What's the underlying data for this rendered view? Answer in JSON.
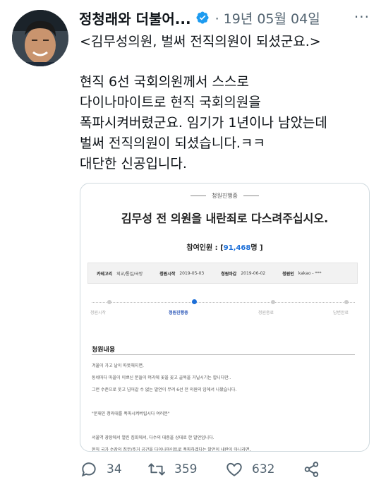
{
  "tweet": {
    "author_name": "정청래와 더불어...",
    "meta": "· 19년 05월 04일",
    "more_label": "···",
    "first_line": "<김무성의원, 벌써 전직의원이 되셨군요.>",
    "body": "현직 6선 국회의원께서 스스로\n다이나마이트로 현직 국회의원을\n폭파시켜버렸군요. 임기가 1년이나 남았는데\n벌써 전직의원이 되셨습니다.ㅋㅋ\n대단한 신공입니다."
  },
  "card": {
    "status": "청원진행중",
    "title": "김무성 전 의원을 내란죄로 다스려주십시오.",
    "participants_label": "참여인원 : [",
    "participants_value": "91,468",
    "participants_suffix": "명 ]",
    "info": {
      "category_label": "카테고리",
      "category_value": "외교/통일/국방",
      "start_label": "청원시작",
      "start_value": "2019-05-03",
      "end_label": "청원마감",
      "end_value": "2019-06-02",
      "author_label": "청원인",
      "author_value": "kakao - ***"
    },
    "steps": [
      "청원시작",
      "청원진행중",
      "청원종료",
      "답변완료"
    ],
    "active_step": 1,
    "section_title": "청원내용",
    "content": "겨울이 가고 날이 따뜻해지면,\n동네마다 마을이 이쁘신 분들이 머리에 꽃을 꽂고 골목을 거닐시기는 합니다만..\n그런 수준으로 웃고 넘어갈 수 없는 발언이 무려 6선 전 의원의 입에서 나왔습니다.\n\n\"문재인 청와대를 폭파시켜버립시다 여러분\"\n\n서울역 광장에서 열린 집회에서, 다수의 대중을 상대로 한 발언입니다.\n현직 국가 수장의 집무/주거 공간을 다이나마이트로 폭파하겠다는 발언이 내란이 아니라면,\n역으로 어떤 행위가 내란이 될 지 되묻지 않을 수 없습니다."
  },
  "actions": {
    "reply_count": "34",
    "retweet_count": "359",
    "like_count": "632"
  },
  "icons": {
    "verified": "verified-badge-icon",
    "reply": "reply-icon",
    "retweet": "retweet-icon",
    "like": "heart-icon",
    "share": "share-icon"
  },
  "colors": {
    "verified": "#1d9bf0",
    "secondary_text": "#536471",
    "active_step": "#1d6fd8"
  }
}
